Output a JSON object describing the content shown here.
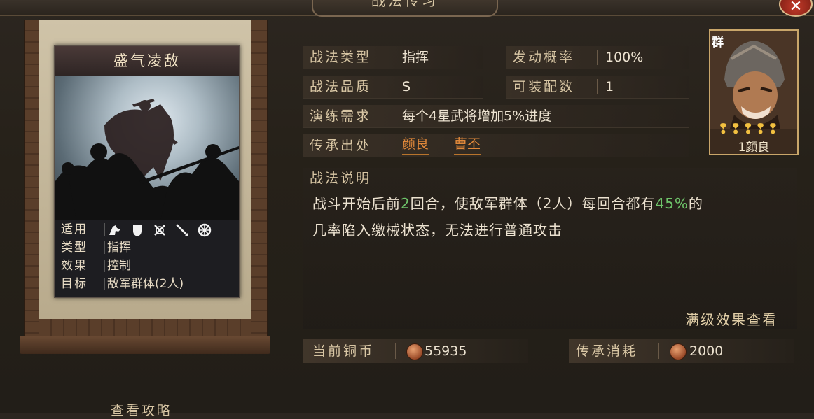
{
  "window": {
    "title": "战法传习"
  },
  "card": {
    "name": "盛气凌敌",
    "stats": [
      {
        "key": "适用",
        "value": ""
      },
      {
        "key": "类型",
        "value": "指挥"
      },
      {
        "key": "效果",
        "value": "控制"
      },
      {
        "key": "目标",
        "value": "敌军群体(2人)"
      }
    ],
    "unit_icons": [
      "cavalry-icon",
      "shield-icon",
      "bow-icon",
      "spear-icon",
      "wheel-icon"
    ]
  },
  "info": {
    "type_label": "战法类型",
    "type_value": "指挥",
    "rate_label": "发动概率",
    "rate_value": "100%",
    "quality_label": "战法品质",
    "quality_value": "S",
    "equip_label": "可装配数",
    "equip_value": "1",
    "drill_label": "演练需求",
    "drill_value": "每个4星武将增加5%进度",
    "source_label": "传承出处",
    "source_1": "颜良",
    "source_2": "曹丕"
  },
  "portrait": {
    "faction": "群",
    "rank_stars": "❢❢❢❢❢",
    "name": "1颜良"
  },
  "description": {
    "title": "战法说明",
    "line1_a": "战斗开始后前",
    "line1_turns": "2",
    "line1_b": "回合，使敌军群体（2人）每回合都有",
    "line1_pct": "45%",
    "line1_c": "的",
    "line2": "几率陷入缴械状态，无法进行普通攻击",
    "full_effect_link": "满级效果查看"
  },
  "coins": {
    "current_label": "当前铜币",
    "current_value": "55935",
    "cost_label": "传承消耗",
    "cost_value": "2000"
  },
  "footer": {
    "guide_label": "查看攻略"
  },
  "colors": {
    "accent_orange": "#e0883a",
    "highlight_green": "#6ec46a",
    "frame_gold": "#c9a66a"
  }
}
